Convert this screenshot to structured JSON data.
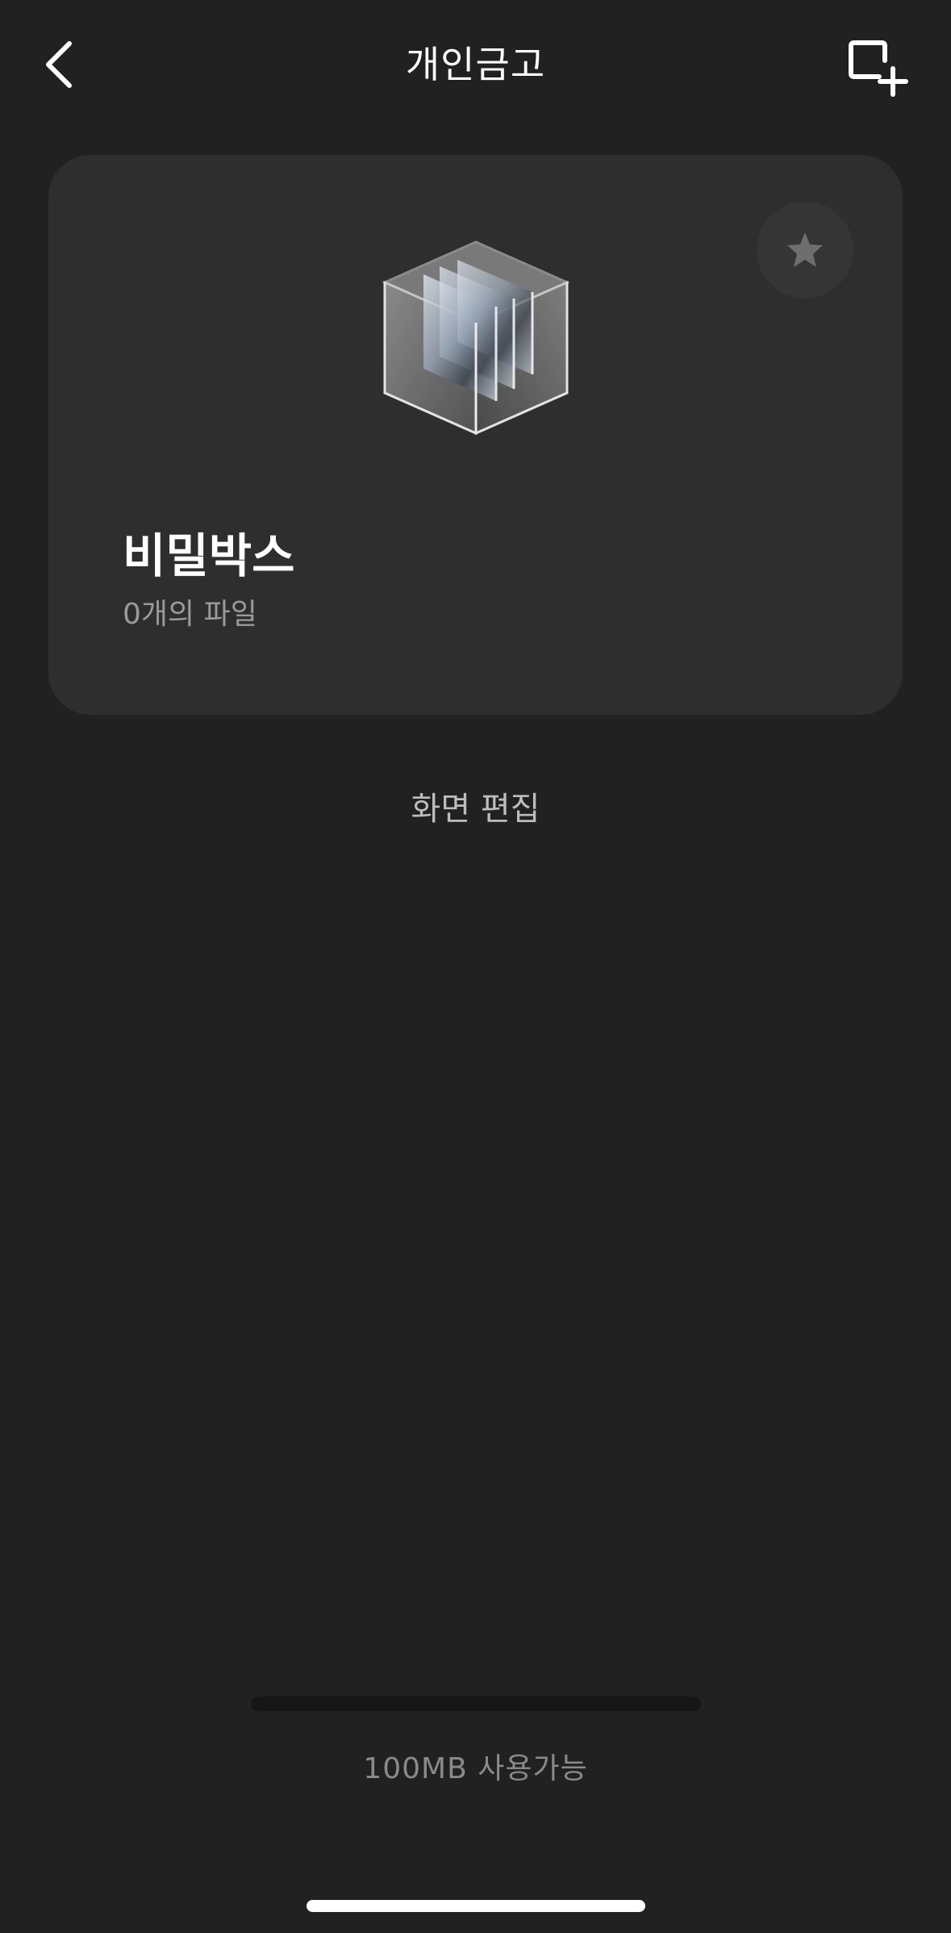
{
  "header": {
    "title": "개인금고",
    "back_icon": "chevron-left-icon",
    "add_icon": "add-box-icon"
  },
  "vault": {
    "name": "비밀박스",
    "file_count": "0개의 파일",
    "favorite_icon": "star-icon",
    "illustration": "glass-box-icon"
  },
  "edit": {
    "label": "화면 편집"
  },
  "storage": {
    "used_fraction": 0,
    "text": "100MB 사용가능"
  },
  "colors": {
    "background": "#212121",
    "card": "#2e2e2e",
    "text_primary": "#ffffff",
    "text_secondary": "#9a9a9a"
  }
}
